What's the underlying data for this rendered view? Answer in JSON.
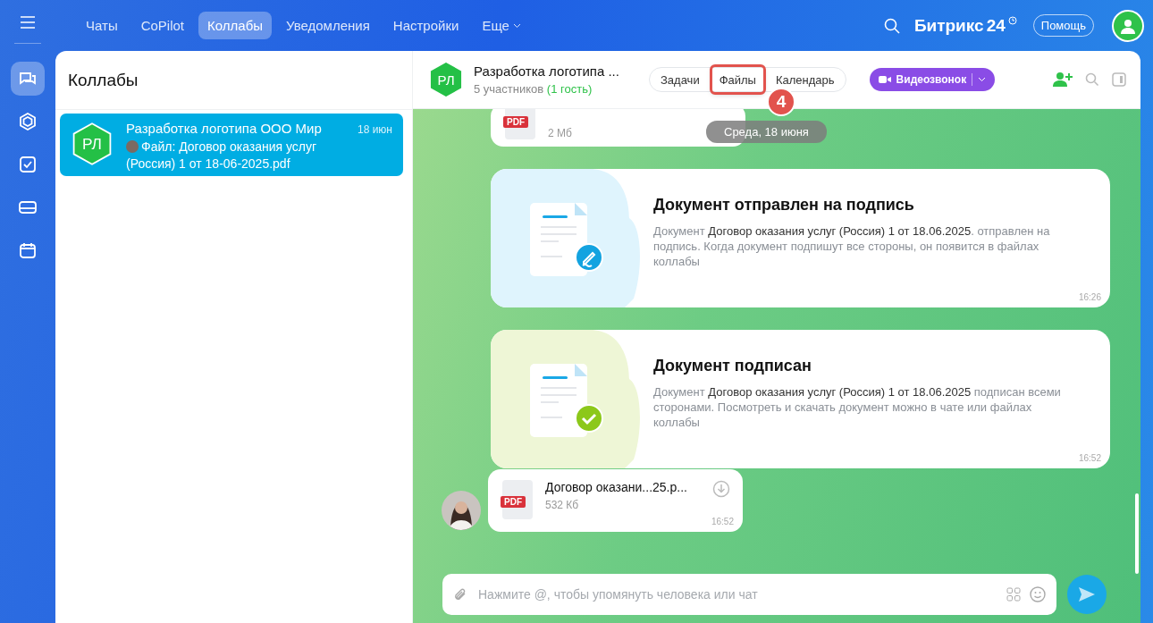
{
  "top_nav": {
    "tabs": [
      {
        "label": "Чаты",
        "selected": false
      },
      {
        "label": "CoPilot",
        "selected": false
      },
      {
        "label": "Коллабы",
        "selected": true
      },
      {
        "label": "Уведомления",
        "selected": false
      },
      {
        "label": "Настройки",
        "selected": false
      }
    ],
    "more": "Еще",
    "logo": "Битрикс",
    "logo_num": "24",
    "help": "Помощь"
  },
  "rail": {
    "items": [
      {
        "kind": "chats",
        "selected": true
      },
      {
        "kind": "collabs",
        "selected": false
      },
      {
        "kind": "tasks",
        "selected": false
      },
      {
        "kind": "drive",
        "selected": false
      },
      {
        "kind": "calendar",
        "selected": false
      }
    ]
  },
  "list": {
    "title": "Коллабы",
    "items": [
      {
        "initials": "РЛ",
        "title": "Разработка логотипа ООО Мир",
        "date": "18 июн",
        "preview": "Файл: Договор оказания услуг (Россия) 1 от 18-06-2025.pdf",
        "selected": true
      }
    ]
  },
  "chat": {
    "header": {
      "initials": "РЛ",
      "title": "Разработка логотипа ...",
      "members": "5 участников",
      "guests": "(1 гость)",
      "tabs": [
        {
          "label": "Задачи",
          "annotated": false
        },
        {
          "label": "Файлы",
          "annotated": true
        },
        {
          "label": "Календарь",
          "annotated": false
        }
      ],
      "annotation_label": "4",
      "call": "Видеозвонок"
    },
    "date_divider": "Среда, 18 июня",
    "messages": [
      {
        "kind": "file_partial",
        "file_type": "PDF",
        "size": "2 Мб"
      },
      {
        "kind": "signature_request",
        "title": "Документ отправлен на подпись",
        "body": "Документ **Договор оказания услуг (Россия) 1 от 18.06.2025**. отправлен на подпись. Когда документ подпишут все стороны, он появится в файлах коллабы",
        "time": "16:26"
      },
      {
        "kind": "signature_done",
        "title": "Документ подписан",
        "body": "Документ **Договор оказания услуг (Россия) 1 от 18.06.2025** подписан всеми сторонами. Посмотреть и скачать документ можно в чате или файлах коллабы",
        "time": "16:52"
      },
      {
        "kind": "file",
        "file_type": "PDF",
        "name": "Договор оказани...25.p...",
        "size": "532 Кб",
        "time": "16:52"
      }
    ],
    "composer": {
      "placeholder": "Нажмите @, чтобы упомянуть человека или чат"
    }
  }
}
